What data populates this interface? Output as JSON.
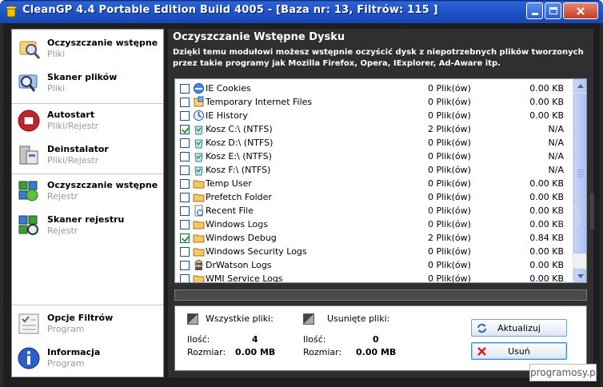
{
  "window": {
    "title": "CleanGP 4.4 Portable Edition Build 4005  - [Baza nr: 13, Filtrów: 115 ]"
  },
  "sidebar": {
    "items": [
      {
        "title": "Oczyszczanie wstępne",
        "sub": "Pliki",
        "icon": "magnifier-folder-icon"
      },
      {
        "title": "Skaner plików",
        "sub": "Pliki",
        "icon": "scan-monitor-icon"
      },
      {
        "title": "Autostart",
        "sub": "Pliki/Rejestr",
        "icon": "autostart-icon"
      },
      {
        "title": "Deinstalator",
        "sub": "Pliki/Rejestr",
        "icon": "uninstaller-icon"
      },
      {
        "title": "Oczyszczanie wstępne",
        "sub": "Rejestr",
        "icon": "registry-clean-icon"
      },
      {
        "title": "Skaner rejestru",
        "sub": "Rejestr",
        "icon": "registry-scan-icon"
      },
      {
        "title": "Opcje Filtrów",
        "sub": "Program",
        "icon": "filter-options-icon"
      },
      {
        "title": "Informacja",
        "sub": "Program",
        "icon": "info-icon"
      }
    ]
  },
  "main": {
    "title": "Oczyszczanie Wstępne Dysku",
    "description": "Dzięki temu modułowi możesz wstępnie oczyścić dysk z niepotrzebnych plików tworzonych przez takie programy jak Mozilla Firefox, Opera, IExplorer, Ad-Aware itp."
  },
  "list": {
    "rows": [
      {
        "name": "IE Cookies",
        "files": "0 Plik(ów)",
        "size": "0.00 KB",
        "checked": false,
        "icon": "ie-icon"
      },
      {
        "name": "Temporary Internet Files",
        "files": "0 Plik(ów)",
        "size": "0.00 KB",
        "checked": false,
        "icon": "temp-files-icon"
      },
      {
        "name": "IE History",
        "files": "0 Plik(ów)",
        "size": "0.00 KB",
        "checked": false,
        "icon": "history-icon"
      },
      {
        "name": "Kosz C:\\ (NTFS)",
        "files": "2 Plik(ów)",
        "size": "N/A",
        "checked": true,
        "icon": "recycle-bin-icon"
      },
      {
        "name": "Kosz D:\\ (NTFS)",
        "files": "0 Plik(ów)",
        "size": "N/A",
        "checked": false,
        "icon": "recycle-bin-icon"
      },
      {
        "name": "Kosz E:\\ (NTFS)",
        "files": "0 Plik(ów)",
        "size": "N/A",
        "checked": false,
        "icon": "recycle-bin-icon"
      },
      {
        "name": "Kosz F:\\ (NTFS)",
        "files": "0 Plik(ów)",
        "size": "N/A",
        "checked": false,
        "icon": "recycle-bin-icon"
      },
      {
        "name": "Temp User",
        "files": "0 Plik(ów)",
        "size": "0.00 KB",
        "checked": false,
        "icon": "folder-icon"
      },
      {
        "name": "Prefetch Folder",
        "files": "0 Plik(ów)",
        "size": "0.00 KB",
        "checked": false,
        "icon": "folder-icon"
      },
      {
        "name": "Recent File",
        "files": "0 Plik(ów)",
        "size": "0.00 KB",
        "checked": false,
        "icon": "recent-file-icon"
      },
      {
        "name": "Windows Logs",
        "files": "0 Plik(ów)",
        "size": "0.00 KB",
        "checked": false,
        "icon": "folder-icon"
      },
      {
        "name": "Windows Debug",
        "files": "2 Plik(ów)",
        "size": "0.84 KB",
        "checked": true,
        "icon": "folder-icon"
      },
      {
        "name": "Windows Security Logs",
        "files": "0 Plik(ów)",
        "size": "0.00 KB",
        "checked": false,
        "icon": "folder-icon"
      },
      {
        "name": "DrWatson Logs",
        "files": "0 Plik(ów)",
        "size": "0.00 KB",
        "checked": false,
        "icon": "drwatson-icon"
      },
      {
        "name": "WMI Service Logs",
        "files": "0 Plik(ów)",
        "size": "0.00 KB",
        "checked": false,
        "icon": "folder-icon"
      }
    ]
  },
  "summary": {
    "all_files_label": "Wszystkie pliki:",
    "deleted_files_label": "Usunięte pliki:",
    "count_label": "Ilość:",
    "size_label": "Rozmiar:",
    "all_count": "4",
    "all_size": "0.00 MB",
    "deleted_count": "0",
    "deleted_size": "0.00 MB"
  },
  "buttons": {
    "refresh": "Aktualizuj",
    "delete": "Usuń"
  },
  "watermark": {
    "text": "programosy.pl",
    "badge": "programosy.pl"
  },
  "colors": {
    "titlebar": "#1e55c8",
    "panel_bg": "#2f2f2f",
    "check": "#21a121"
  }
}
